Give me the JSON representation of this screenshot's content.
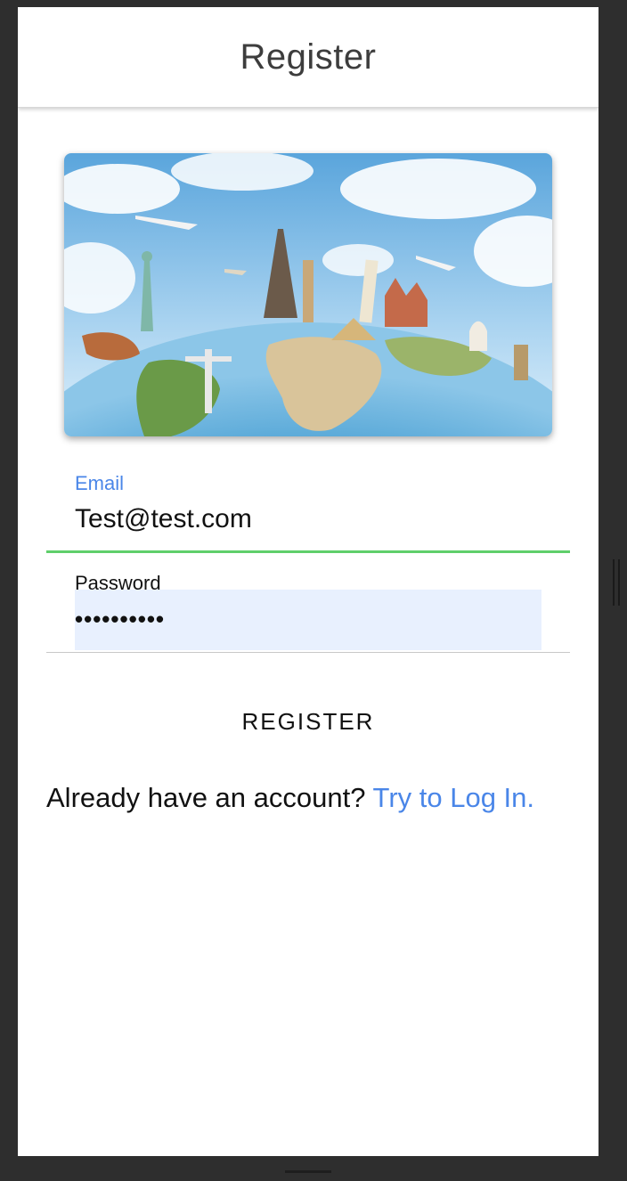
{
  "header": {
    "title": "Register"
  },
  "hero": {
    "image_name": "travel-world-landmarks"
  },
  "form": {
    "email": {
      "label": "Email",
      "value": "Test@test.com"
    },
    "password": {
      "label": "Password",
      "value": "••••••••••"
    }
  },
  "actions": {
    "register_label": "REGISTER"
  },
  "login_prompt": {
    "text": "Already have an account?",
    "link_label": "Try to Log In."
  },
  "colors": {
    "accent": "#4a86e8",
    "focus_underline": "#5fcf6b",
    "autofill_bg": "#e8f0fe"
  }
}
